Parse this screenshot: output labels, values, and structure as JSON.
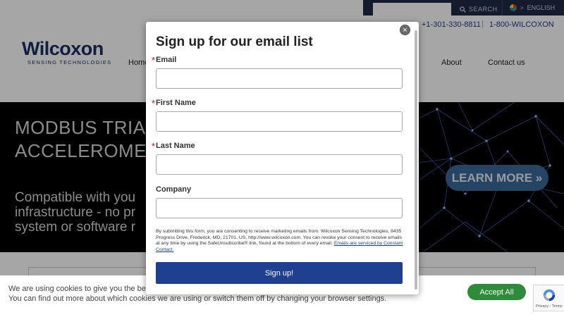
{
  "topbar": {
    "search_placeholder": "",
    "search_label": "SEARCH",
    "language": "ENGLISH"
  },
  "header": {
    "logo_name": "Wilcoxon",
    "logo_tagline": "SENSING TECHNOLOGIES",
    "phone_primary": "+1-301-330-8811",
    "separator": "|",
    "phone_tollfree": "1-800-WILCOXON",
    "nav": {
      "home": "Home",
      "about": "About",
      "contact": "Contact us"
    }
  },
  "hero": {
    "title": "MODBUS TRIA\nACCELEROME",
    "text": "Compatible with you\ninfrastructure - no pr\nsystem or software r",
    "learn_more": "LEARN MORE »"
  },
  "modal": {
    "title": "Sign up for our email list",
    "close_glyph": "×",
    "required_mark": "*",
    "fields": {
      "email": {
        "label": "Email",
        "value": ""
      },
      "first_name": {
        "label": "First Name",
        "value": ""
      },
      "last_name": {
        "label": "Last Name",
        "value": ""
      },
      "company": {
        "label": "Company",
        "value": ""
      }
    },
    "legal_text": "By submitting this form, you are consenting to receive marketing emails from: Wilcoxon Sensing Technologies, 8435 Progress Drive, Frederick, MD, 21701, US, http://www.wilcoxon.com. You can revoke your consent to receive emails at any time by using the SafeUnsubscribe® link, found at the bottom of every email. ",
    "legal_link": "Emails are serviced by Constant Contact.",
    "submit": "Sign up!"
  },
  "cookie": {
    "line1": "We are using cookies to give you the best ex",
    "line2": "You can find out more about which cookies we are using or switch them off by changing your browser settings.",
    "accept": "Accept All"
  },
  "recaptcha": {
    "links": "Privacy - Terms"
  },
  "colors": {
    "brand_navy": "#1a2f66",
    "submit_blue": "#1f3f91",
    "accept_green": "#2e8b3a",
    "required_red": "#d0021b"
  }
}
